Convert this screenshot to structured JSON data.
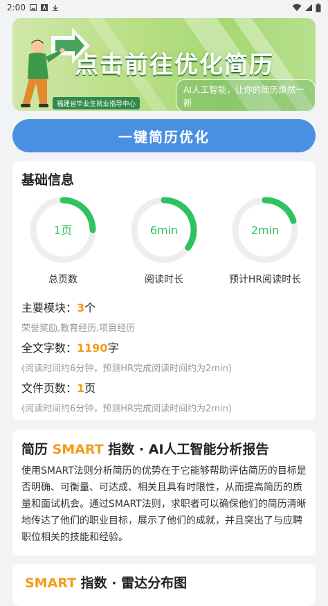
{
  "status_bar": {
    "time": "2:00",
    "notification_icons": [
      "image-icon",
      "text-icon",
      "download-icon"
    ],
    "system_icons": [
      "wifi-icon",
      "signal-icon",
      "battery-icon"
    ]
  },
  "banner": {
    "title": "点击前往优化简历",
    "subtitle": "AI人工智能，让你的简历焕然一新",
    "org": "福建省毕业生就业指导中心"
  },
  "optimize_button": {
    "label": "一键简历优化"
  },
  "basic_info": {
    "title": "基础信息",
    "gauges": [
      {
        "value": "1页",
        "label": "总页数",
        "fraction": 0.25
      },
      {
        "value": "6min",
        "label": "阅读时长",
        "fraction": 0.35
      },
      {
        "value": "2min",
        "label": "预计HR阅读时长",
        "fraction": 0.2
      }
    ],
    "colors": {
      "accent": "#2ec35f",
      "track": "#eeeeee",
      "highlight": "#f29b1d"
    },
    "modules": {
      "label": "主要模块：",
      "count": "3",
      "unit": "个",
      "detail": "荣誉奖励,教育经历,项目经历"
    },
    "word_count": {
      "label": "全文字数：",
      "count": "1190",
      "unit": "字",
      "detail": "(阅读时间约6分钟，预测HR完成阅读时间约为2min)"
    },
    "page_count": {
      "label": "文件页数：",
      "count": "1",
      "unit": "页",
      "detail": "(阅读时间约6分钟，预测HR完成阅读时间约为2min)"
    }
  },
  "smart_report": {
    "title_prefix": "简历 ",
    "title_highlight": "SMART",
    "title_suffix": " 指数 · AI人工智能分析报告",
    "body": "使用SMART法则分析简历的优势在于它能够帮助评估简历的目标是否明确、可衡量、可达成、相关且具有时限性，从而提高简历的质量和面试机会。通过SMART法则，求职者可以确保他们的简历清晰地传达了他们的职业目标，展示了他们的成就，并且突出了与应聘职位相关的技能和经验。"
  },
  "radar": {
    "title_highlight": "SMART",
    "title_suffix": " 指数 · 雷达分布图"
  }
}
